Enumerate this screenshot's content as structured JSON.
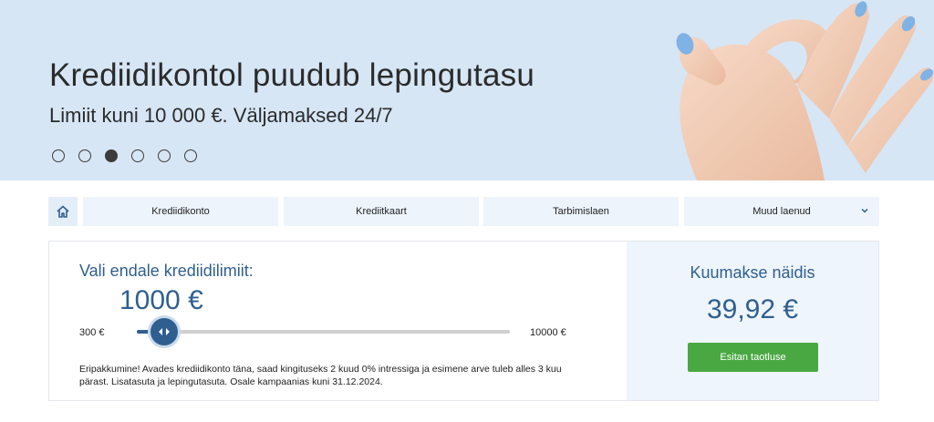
{
  "hero": {
    "title": "Krediidikontol puudub lepingutasu",
    "subtitle": "Limiit kuni 10 000 €. Väljamaksed 24/7",
    "slides": 6,
    "active_slide": 3
  },
  "nav": {
    "home_icon": "home-icon",
    "items": [
      {
        "label": "Krediidikonto"
      },
      {
        "label": "Krediitkaart"
      },
      {
        "label": "Tarbimislaen"
      },
      {
        "label": "Muud laenud",
        "has_dropdown": true
      }
    ]
  },
  "calculator": {
    "pick_label": "Vali endale krediidilimiit:",
    "amount": "1000 €",
    "min_label": "300 €",
    "max_label": "10000 €",
    "slider_min": 300,
    "slider_max": 10000,
    "slider_value": 1000,
    "promo_text": "Eripakkumine! Avades krediidikonto täna, saad kingituseks 2 kuud 0% intressiga ja esimene arve tuleb alles 3 kuu pärast. Lisatasuta ja lepingutasuta. Osale kampaanias kuni 31.12.2024."
  },
  "summary": {
    "title": "Kuumakse näidis",
    "value": "39,92 €",
    "apply_label": "Esitan taotluse"
  },
  "colors": {
    "accent": "#2f5f8f",
    "hero_bg": "#d6e6f5",
    "button_green": "#4aa843",
    "panel_side": "#eef5fc"
  }
}
